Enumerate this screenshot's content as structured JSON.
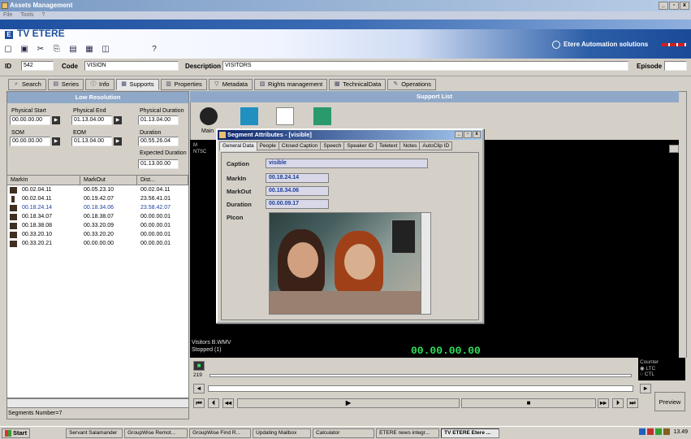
{
  "window": {
    "title": "Assets Management",
    "menu": [
      "File",
      "Tools",
      "?"
    ]
  },
  "banner": {
    "title": "TV ETERE",
    "brand": "Etere Automation solutions"
  },
  "idrow": {
    "id_label": "ID",
    "id_value": "542",
    "code_label": "Code",
    "code_value": "VISION",
    "desc_label": "Description",
    "desc_value": "VISITORS",
    "episode_label": "Episode"
  },
  "tabs": [
    "Search",
    "Series",
    "Info",
    "Supports",
    "Properties",
    "Metadata",
    "Rights management",
    "TechnicalData",
    "Operations"
  ],
  "left": {
    "header": "Low Resolution",
    "physical_start_label": "Physical Start",
    "physical_start": "00.00.00.00",
    "physical_end_label": "Physical End",
    "physical_end": "01.13.04.00",
    "physical_duration_label": "Physical Duration",
    "physical_duration": "01.13.04.00",
    "som_label": "SOM",
    "som": "00.00.00.00",
    "eom_label": "EOM",
    "eom": "01.13.04.00",
    "duration_label": "Duration",
    "duration": "00.55.26.04",
    "expected_label": "Expected Duration",
    "expected": "01.13.00.00",
    "columns": [
      "MarkIn",
      "MarkOut",
      "Dist..."
    ],
    "rows": [
      [
        "00.02.04.11",
        "00.05.23.10",
        "00.02.04.11"
      ],
      [
        "00.02.04.11",
        "00.19.42.07",
        "23.56.41.01"
      ],
      [
        "00.18.24.14",
        "00.18.34.06",
        "23.58.42.07"
      ],
      [
        "00.18.34.07",
        "00.18.38.07",
        "00.00.00.01"
      ],
      [
        "00.18.38.08",
        "00.33.20.09",
        "00.00.00.01"
      ],
      [
        "00.33.20.10",
        "00.33.20.20",
        "00.00.00.01"
      ],
      [
        "00.33.20.21",
        "00.00.00.00",
        "00.00.00.01"
      ]
    ],
    "segments": "Segments Number=7"
  },
  "support": {
    "header": "Support List",
    "main_label": "Main",
    "video_label1": "M",
    "video_label2": "NTSC"
  },
  "dialog": {
    "title": "Segment Attributes - [visible]",
    "tabs": [
      "General Data",
      "People",
      "Closed Caption",
      "Speech",
      "Speaker ID",
      "Teletext",
      "Notes",
      "AutoClip ID"
    ],
    "caption_label": "Caption",
    "caption": "visible",
    "markin_label": "MarkIn",
    "markin": "00.18.24.14",
    "markout_label": "MarkOut",
    "markout": "00.18.34.06",
    "duration_label": "Duration",
    "duration": "00.00.09.17",
    "picon_label": "PIcon"
  },
  "player": {
    "status1": "Visitors B.WMV",
    "status2": "Stopped (1)",
    "timecode": "00.00.00.00",
    "position": "219",
    "counter_label": "Counter",
    "ltc": "LTC",
    "ctl": "CTL",
    "preview": "Preview"
  },
  "taskbar": {
    "start": "Start",
    "items": [
      "Servant Salamander",
      "GroupWise Remot...",
      "GroupWise Find R...",
      "Updating Mailbox",
      "Calculator",
      "ETERE news integr...",
      "TV ETERE Etere ..."
    ],
    "clock": "13.49"
  }
}
